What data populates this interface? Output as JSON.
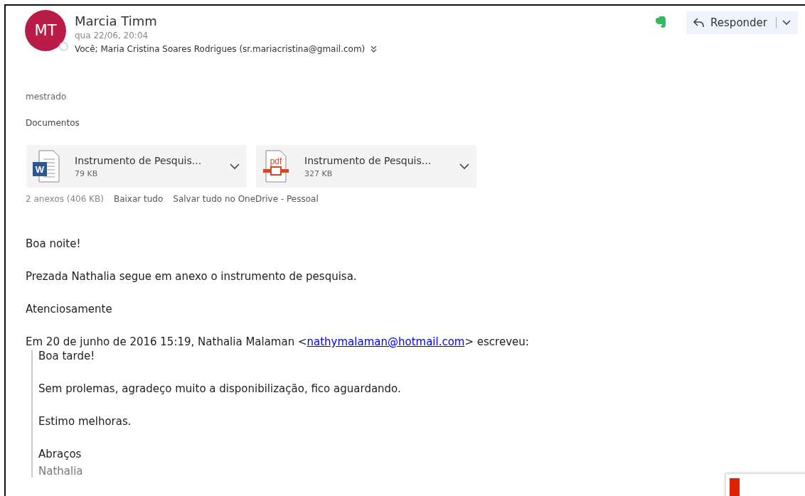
{
  "header": {
    "initials": "MT",
    "sender": "Marcia Timm",
    "date": "qua 22/06, 20:04",
    "recipients": "Você; Maria Cristina Soares Rodrigues (sr.mariacristina@gmail.com)"
  },
  "reply_button": {
    "label": "Responder"
  },
  "subject_tag": "mestrado",
  "folder": "Documentos",
  "attachments": [
    {
      "kind": "word",
      "icon_text": "W",
      "name": "Instrumento de Pesquis...",
      "size": "79 KB"
    },
    {
      "kind": "pdf",
      "icon_text": "pdf",
      "name": "Instrumento de Pesquis...",
      "size": "327 KB"
    }
  ],
  "attachment_summary": {
    "count": "2 anexos (406 KB)",
    "download_all": "Baixar tudo",
    "save_all": "Salvar tudo no OneDrive - Pessoal"
  },
  "body": [
    "Boa noite!",
    "Prezada Nathalia segue em anexo o instrumento de pesquisa.",
    "Atenciosamente"
  ],
  "quote_header": {
    "before": "Em 20 de junho de 2016 15:19, Nathalia Malaman <",
    "link": "nathymalaman@hotmail.com",
    "after": "> escreveu:"
  },
  "quoted": [
    {
      "kind": "text",
      "text": "Boa tarde!"
    },
    {
      "kind": "text",
      "text": "Sem prolemas, agradeço muito a disponibilização, fico aguardando."
    },
    {
      "kind": "text",
      "text": "Estimo melhoras."
    },
    {
      "kind": "text",
      "text": "Abraços"
    },
    {
      "kind": "signature",
      "text": "Nathalia"
    }
  ]
}
